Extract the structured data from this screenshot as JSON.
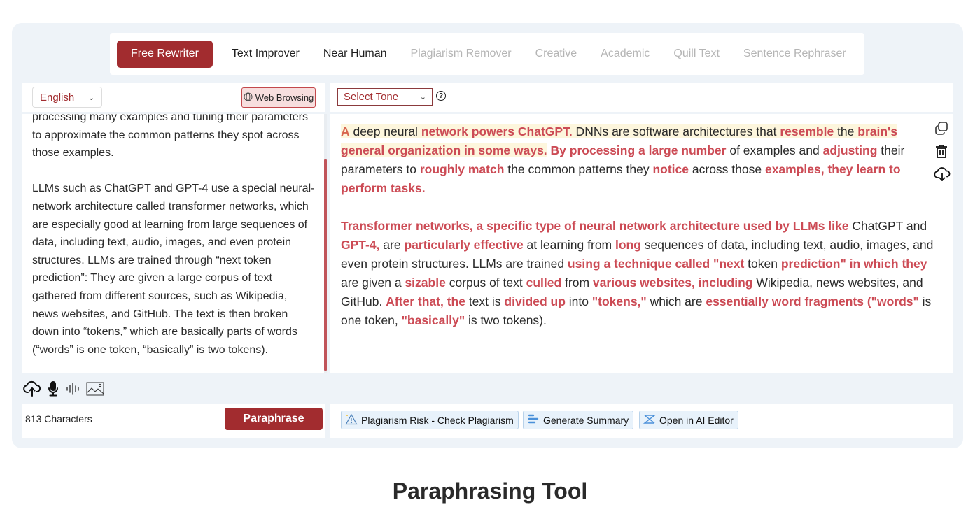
{
  "modes": [
    {
      "label": "Free Rewriter",
      "state": "active"
    },
    {
      "label": "Text Improver",
      "state": "enabled"
    },
    {
      "label": "Near Human",
      "state": "enabled"
    },
    {
      "label": "Plagiarism Remover",
      "state": "disabled"
    },
    {
      "label": "Creative",
      "state": "disabled"
    },
    {
      "label": "Academic",
      "state": "disabled"
    },
    {
      "label": "Quill Text",
      "state": "disabled"
    },
    {
      "label": "Sentence Rephraser",
      "state": "disabled"
    }
  ],
  "input": {
    "language": "English",
    "web_browsing_label": "Web Browsing",
    "paragraphs": [
      "processing many examples and tuning their parameters to approximate the common patterns they spot across those examples.",
      "LLMs such as ChatGPT and GPT-4 use a special neural-network architecture called transformer networks, which are especially good at learning from large sequences of data, including text, audio, images, and even protein structures. LLMs are trained through “next token prediction”: They are given a large corpus of text gathered from different sources, such as Wikipedia, news websites, and GitHub. The text is then broken down into “tokens,” which are basically parts of words (“words” is one token, “basically” is two tokens)."
    ],
    "char_count": "813 Characters",
    "paraphrase_label": "Paraphrase",
    "tool_icons": [
      "upload-cloud-icon",
      "microphone-icon",
      "audio-wave-icon",
      "image-icon"
    ]
  },
  "output": {
    "tone_placeholder": "Select Tone",
    "help_glyph": "?",
    "paragraphs": [
      [
        {
          "t": "A",
          "h": true,
          "y": true
        },
        {
          "t": " deep neural ",
          "h": false,
          "y": true
        },
        {
          "t": "network powers ChatGPT.",
          "h": true,
          "y": true
        },
        {
          "t": " DNNs are software architectures that ",
          "h": false,
          "y": true
        },
        {
          "t": "resemble",
          "h": true,
          "y": true
        },
        {
          "t": " the ",
          "h": false,
          "y": true
        },
        {
          "t": "brain's general organization in some ways.",
          "h": true,
          "y": true
        },
        {
          "t": " ",
          "h": false,
          "y": false
        },
        {
          "t": "By processing a large number",
          "h": true,
          "y": false
        },
        {
          "t": " of examples and ",
          "h": false,
          "y": false
        },
        {
          "t": "adjusting",
          "h": true,
          "y": false
        },
        {
          "t": " their parameters to ",
          "h": false,
          "y": false
        },
        {
          "t": "roughly match",
          "h": true,
          "y": false
        },
        {
          "t": " the common patterns they ",
          "h": false,
          "y": false
        },
        {
          "t": "notice",
          "h": true,
          "y": false
        },
        {
          "t": " across those ",
          "h": false,
          "y": false
        },
        {
          "t": "examples, they learn to perform tasks.",
          "h": true,
          "y": false
        }
      ],
      [
        {
          "t": "Transformer networks, a specific type of neural network architecture used by LLMs like",
          "h": true
        },
        {
          "t": " ChatGPT and ",
          "h": false
        },
        {
          "t": "GPT-4,",
          "h": true
        },
        {
          "t": " are ",
          "h": false
        },
        {
          "t": "particularly effective",
          "h": true
        },
        {
          "t": " at learning from ",
          "h": false
        },
        {
          "t": "long",
          "h": true
        },
        {
          "t": " sequences of data, including text, audio, images, and even protein structures. LLMs are trained ",
          "h": false
        },
        {
          "t": "using a technique called \"next",
          "h": true
        },
        {
          "t": " token ",
          "h": false
        },
        {
          "t": "prediction\" in which they",
          "h": true
        },
        {
          "t": " are given a ",
          "h": false
        },
        {
          "t": "sizable",
          "h": true
        },
        {
          "t": " corpus of text ",
          "h": false
        },
        {
          "t": "culled",
          "h": true
        },
        {
          "t": " from ",
          "h": false
        },
        {
          "t": "various websites, including",
          "h": true
        },
        {
          "t": " Wikipedia, news websites, and GitHub. ",
          "h": false
        },
        {
          "t": "After that, the",
          "h": true
        },
        {
          "t": " text is ",
          "h": false
        },
        {
          "t": "divided up",
          "h": true
        },
        {
          "t": " into ",
          "h": false
        },
        {
          "t": "\"tokens,\"",
          "h": true
        },
        {
          "t": " which are ",
          "h": false
        },
        {
          "t": "essentially word fragments (\"words\"",
          "h": true
        },
        {
          "t": " is one token, ",
          "h": false
        },
        {
          "t": "\"basically\"",
          "h": true
        },
        {
          "t": " is two tokens).",
          "h": false
        }
      ]
    ],
    "side_icons": [
      "copy-icon",
      "trash-icon",
      "download-cloud-icon"
    ],
    "actions": [
      {
        "label": "Plagiarism Risk - Check Plagiarism",
        "icon": "warning-triangle-icon"
      },
      {
        "label": "Generate Summary",
        "icon": "summary-bars-icon"
      },
      {
        "label": "Open in AI Editor",
        "icon": "ai-editor-icon"
      }
    ]
  },
  "colors": {
    "brand": "#a22c2f",
    "highlight": "#cc4b55",
    "highlight_bg": "#fdf6dd",
    "action_bg": "#e8f2fb"
  },
  "page_heading": "Paraphrasing Tool"
}
